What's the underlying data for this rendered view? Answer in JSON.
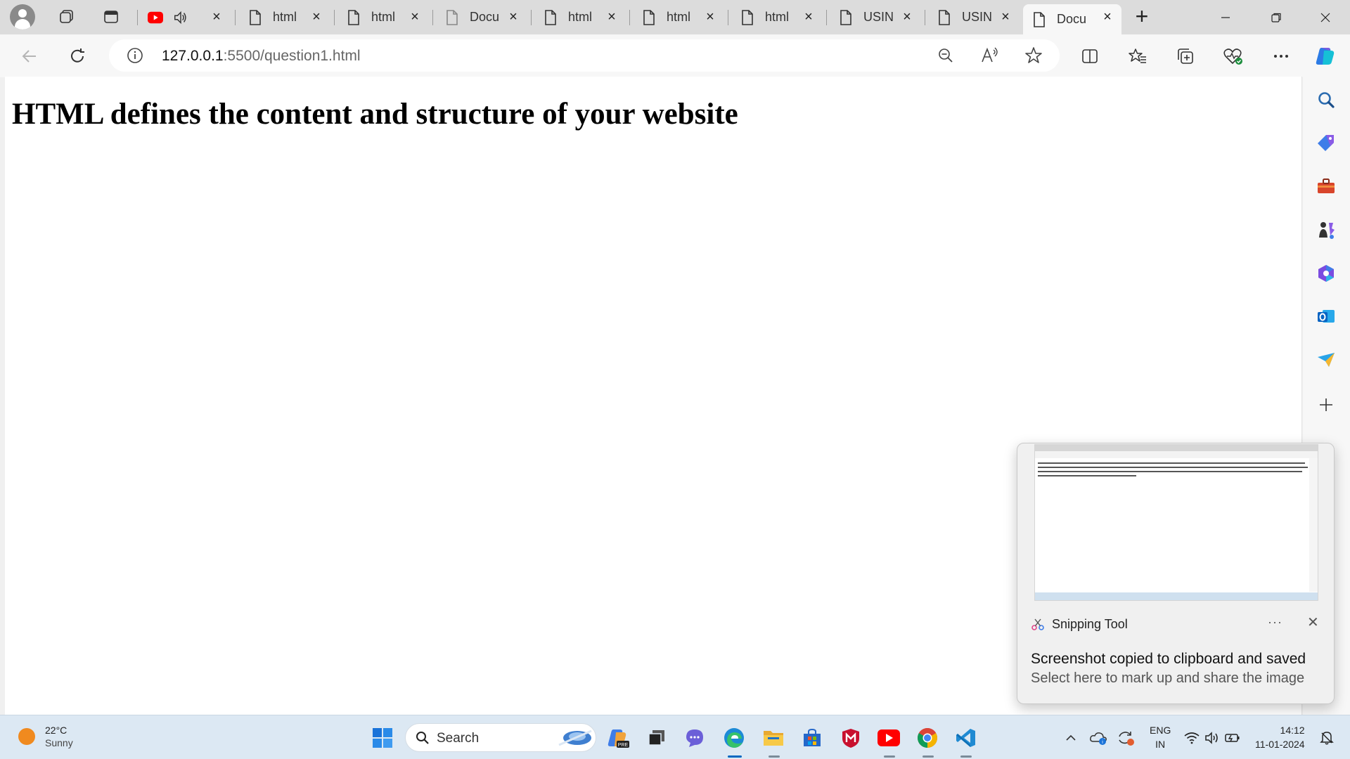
{
  "browser": {
    "tabs": [
      {
        "label": "",
        "kind": "youtube",
        "playing_audio": true
      },
      {
        "label": "html",
        "kind": "page"
      },
      {
        "label": "html",
        "kind": "page"
      },
      {
        "label": "Docu",
        "kind": "doc"
      },
      {
        "label": "html",
        "kind": "page"
      },
      {
        "label": "html",
        "kind": "page"
      },
      {
        "label": "html",
        "kind": "page"
      },
      {
        "label": "USIN",
        "kind": "page"
      },
      {
        "label": "USIN",
        "kind": "page"
      },
      {
        "label": "Docu",
        "kind": "page",
        "active": true
      }
    ],
    "url_host": "127.0.0.1",
    "url_path": ":5500/question1.html"
  },
  "page": {
    "heading": "HTML defines the content and structure of your website"
  },
  "sidebar_icons": [
    "search-icon",
    "shopping-tag-icon",
    "toolbox-icon",
    "games-icon",
    "microsoft365-icon",
    "outlook-icon",
    "send-icon",
    "add-icon"
  ],
  "toast": {
    "app_name": "Snipping Tool",
    "more": "···",
    "title": "Screenshot copied to clipboard and saved",
    "body": "Select here to mark up and share the image"
  },
  "taskbar": {
    "temperature": "22°C",
    "condition": "Sunny",
    "search_label": "Search",
    "lang_top": "ENG",
    "lang_bottom": "IN",
    "time": "14:12",
    "date": "11-01-2024"
  },
  "colors": {
    "accent": "#0067c0",
    "youtube": "#ff0000"
  }
}
